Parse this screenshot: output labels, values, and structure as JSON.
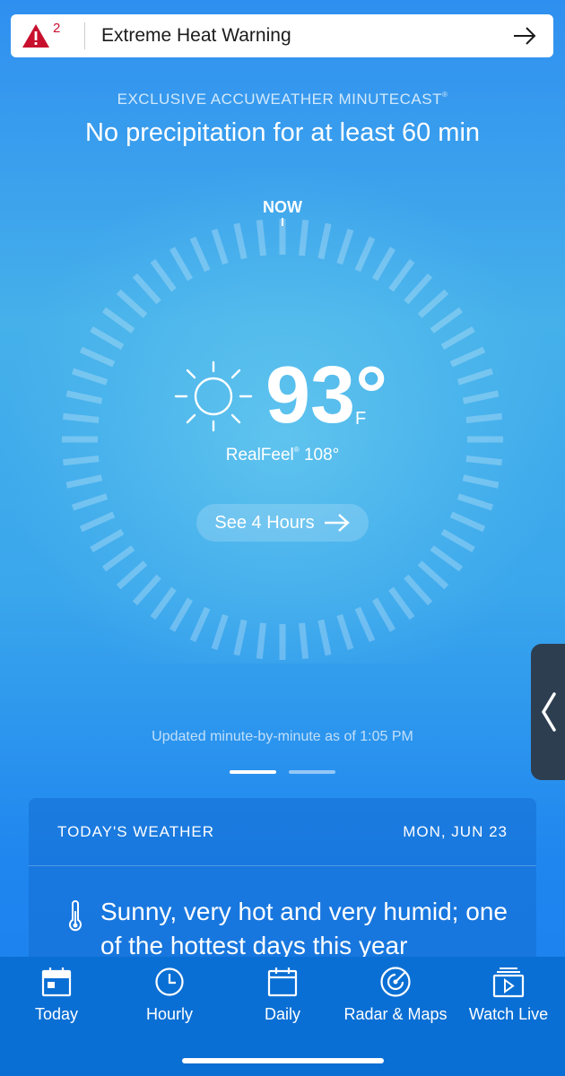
{
  "alert": {
    "count": "2",
    "title": "Extreme Heat Warning"
  },
  "minutecast": {
    "label": "EXCLUSIVE ACCUWEATHER MINUTECAST",
    "mark": "®",
    "summary": "No precipitation for at least 60 min"
  },
  "dial": {
    "now_label": "NOW"
  },
  "current": {
    "temperature": "93°",
    "unit": "F",
    "realfeel_label": "RealFeel",
    "realfeel_mark": "®",
    "realfeel_value": "108°",
    "condition_icon": "sun-icon"
  },
  "see_hours": {
    "label": "See 4 Hours"
  },
  "updated": "Updated minute-by-minute as of 1:05 PM",
  "pager": {
    "pages": 2,
    "active": 0
  },
  "todays_weather": {
    "title": "TODAY'S WEATHER",
    "date": "MON, JUN 23",
    "forecast": "Sunny, very hot and very humid; one of the hottest days this year"
  },
  "tabs": [
    {
      "label": "Today",
      "icon": "calendar-today-icon"
    },
    {
      "label": "Hourly",
      "icon": "clock-icon"
    },
    {
      "label": "Daily",
      "icon": "calendar-icon"
    },
    {
      "label": "Radar & Maps",
      "icon": "radar-icon"
    },
    {
      "label": "Watch Live",
      "icon": "watch-live-icon"
    }
  ],
  "colors": {
    "alert_red": "#c8102e",
    "tabbar": "#0a6fd4",
    "side_tab": "#2d3e50"
  }
}
